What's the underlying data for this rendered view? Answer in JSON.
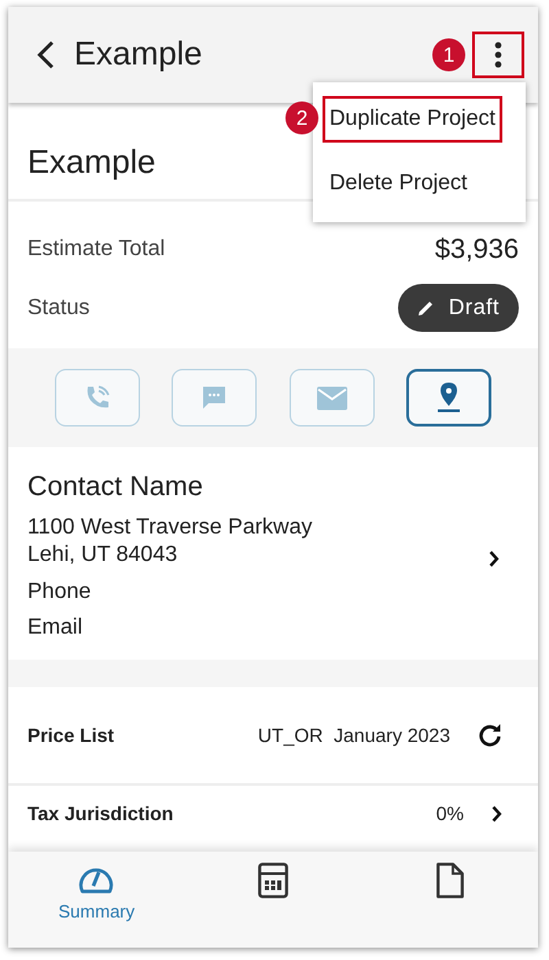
{
  "header": {
    "title": "Example",
    "menu_annotation": "1"
  },
  "menu": {
    "items": [
      {
        "label": "Duplicate Project",
        "highlighted": true,
        "annotation": "2"
      },
      {
        "label": "Delete Project",
        "highlighted": false
      }
    ]
  },
  "project": {
    "title": "Example"
  },
  "summary": [
    {
      "label": "Estimate Total",
      "value": "$3,936",
      "kind": "amount"
    },
    {
      "label": "Status",
      "value": "Draft",
      "kind": "status"
    }
  ],
  "actions": [
    {
      "kind": "phone",
      "selected": false
    },
    {
      "kind": "message",
      "selected": false
    },
    {
      "kind": "email",
      "selected": false
    },
    {
      "kind": "location",
      "selected": true
    }
  ],
  "contact": {
    "name": "Contact Name",
    "address": [
      "1100 West Traverse Parkway",
      "Lehi, UT 84043"
    ],
    "phone": "Phone",
    "email": "Email"
  },
  "details": [
    {
      "label": "Price List",
      "value": "UT_OR  January 2023",
      "kind": "refresh"
    },
    {
      "label": "Tax Jurisdiction",
      "value": "0%",
      "kind": "chevron"
    }
  ],
  "bottom_nav": [
    {
      "kind": "summary",
      "label": "Summary",
      "selected": true
    },
    {
      "kind": "calculator",
      "selected": false
    },
    {
      "kind": "document",
      "selected": false
    }
  ]
}
